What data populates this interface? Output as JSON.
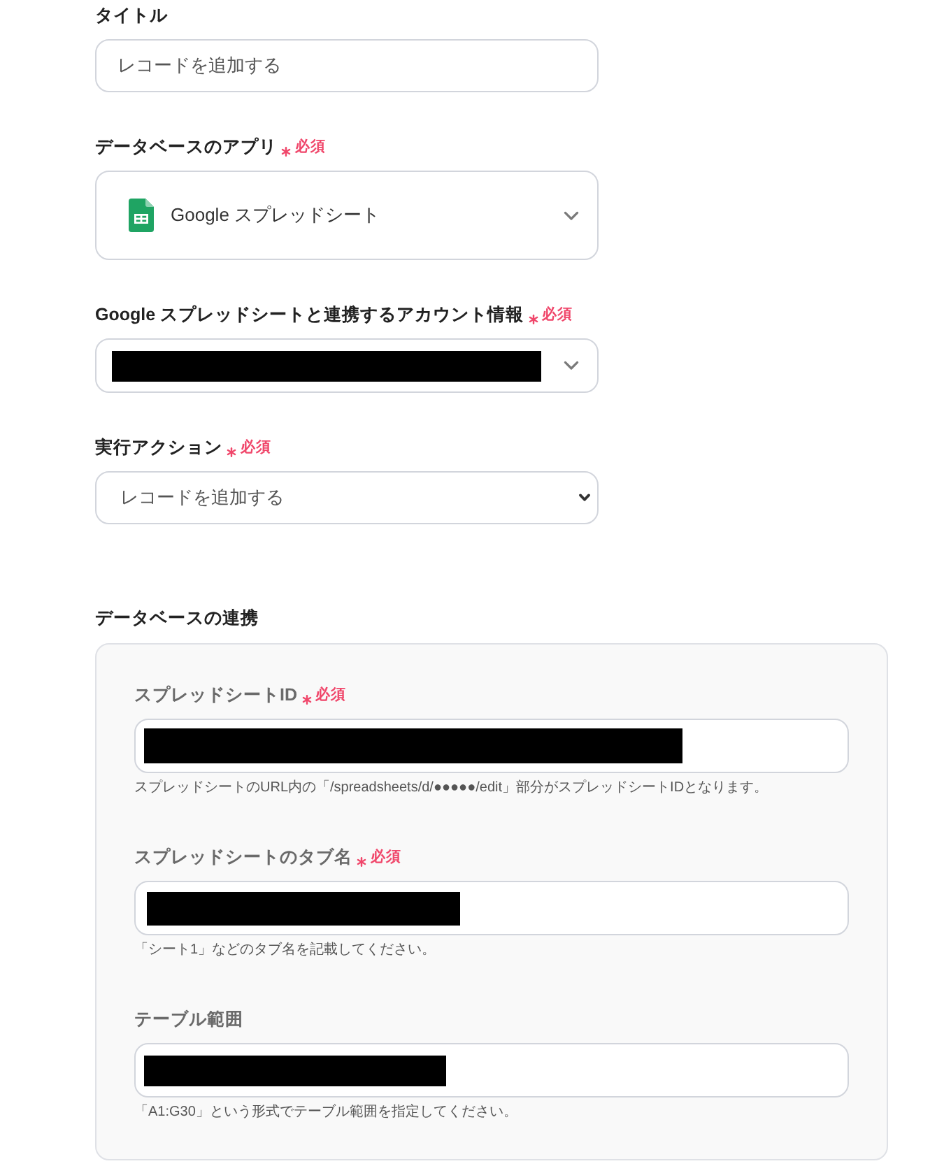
{
  "fields": [
    {
      "kind": "text",
      "label": "タイトル",
      "required": false,
      "redacted": false,
      "value": "レコードを追加する"
    },
    {
      "kind": "app_select",
      "label": "データベースのアプリ",
      "required": true,
      "required_label": "必須",
      "redacted": false,
      "value": "Google スプレッドシート"
    },
    {
      "kind": "select",
      "label": "Google スプレッドシートと連携するアカウント情報",
      "required": true,
      "required_label": "必須",
      "redacted": true
    },
    {
      "kind": "native_select",
      "label": "実行アクション",
      "required": true,
      "required_label": "必須",
      "redacted": false,
      "value": "レコードを追加する"
    }
  ],
  "database_link": {
    "heading": "データベースの連携",
    "fields": [
      {
        "label": "スプレッドシートID",
        "required": true,
        "required_label": "必須",
        "redacted": true,
        "help": "スプレッドシートのURL内の「/spreadsheets/d/●●●●●/edit」部分がスプレッドシートIDとなります。"
      },
      {
        "label": "スプレッドシートのタブ名",
        "required": true,
        "required_label": "必須",
        "redacted": true,
        "help": "「シート1」などのタブ名を記載してください。"
      },
      {
        "label": "テーブル範囲",
        "required": false,
        "redacted": true,
        "help": "「A1:G30」という形式でテーブル範囲を指定してください。"
      }
    ]
  }
}
